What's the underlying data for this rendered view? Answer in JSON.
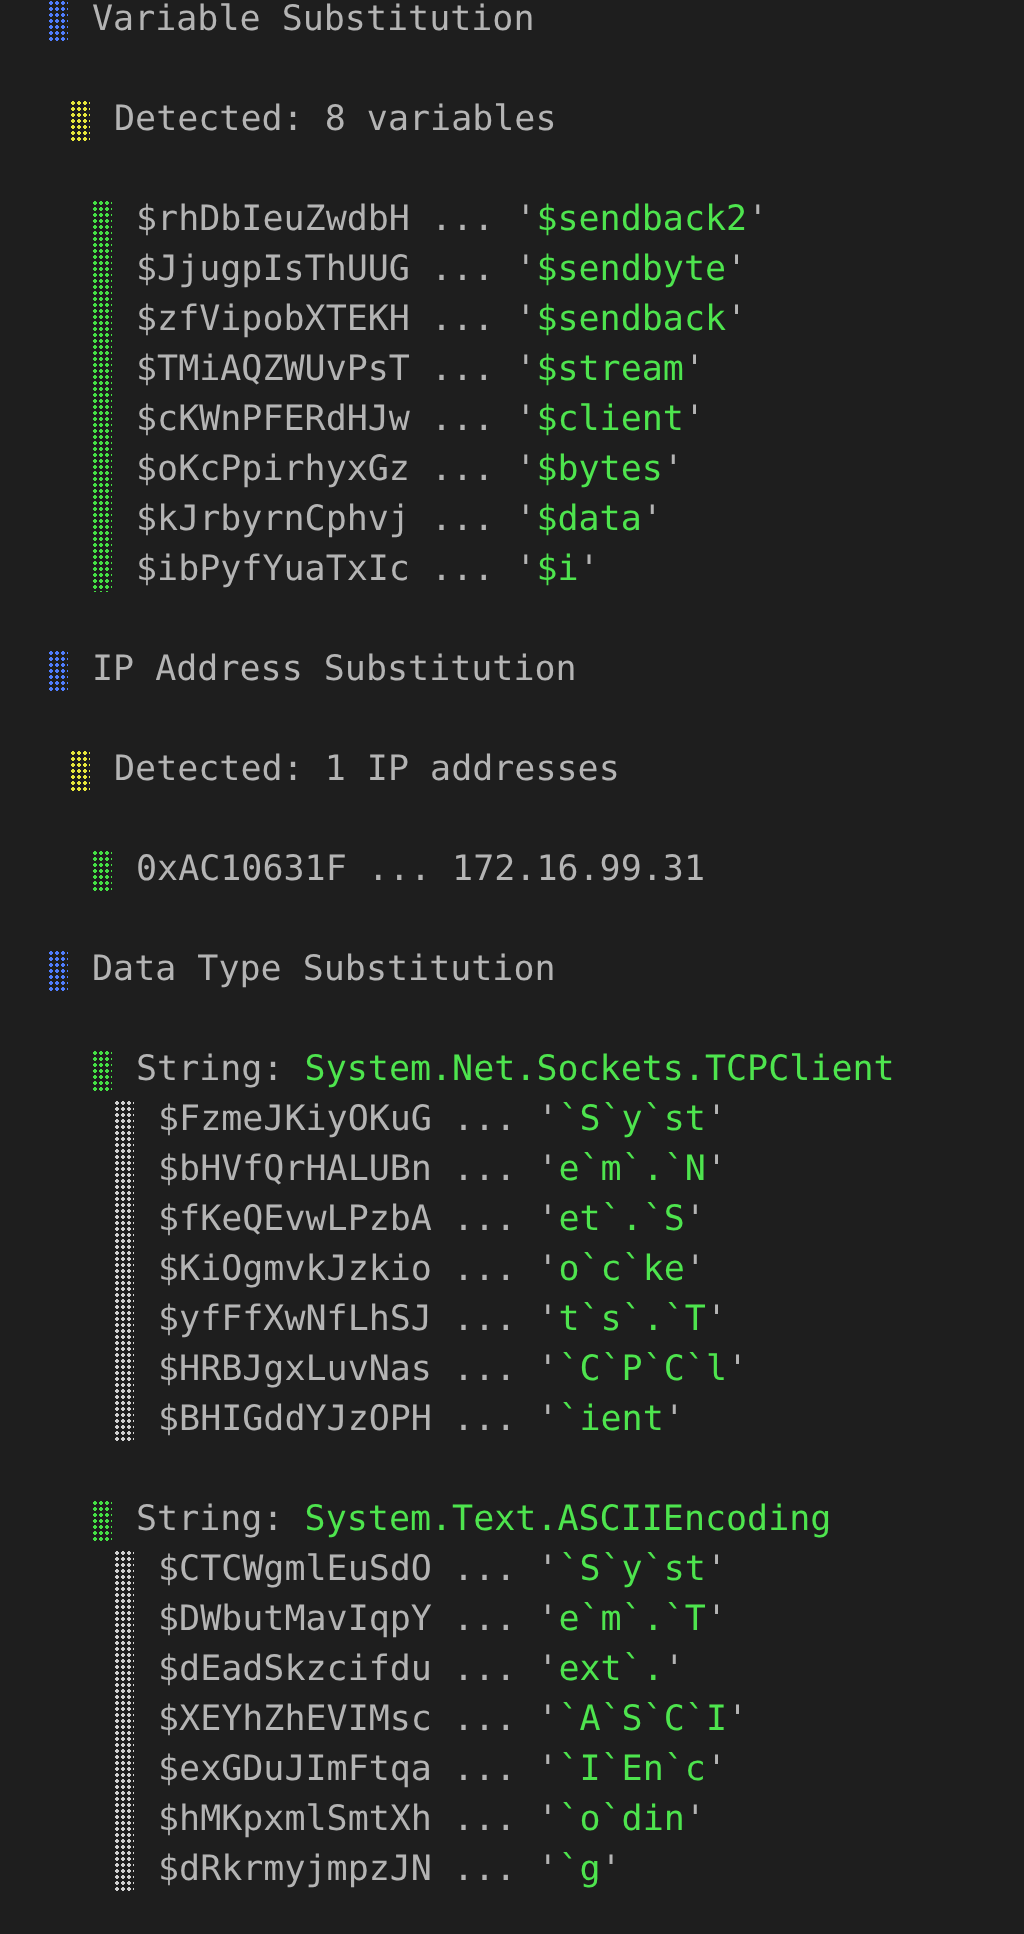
{
  "sections": [
    {
      "title": "Variable Substitution",
      "summary": "Detected: 8 variables",
      "groups": [
        {
          "kind": "mapping",
          "rows": [
            {
              "name": "$rhDbIeuZwdbH",
              "sep": "...",
              "value": "'$sendback2'"
            },
            {
              "name": "$JjugpIsThUUG",
              "sep": "...",
              "value": "'$sendbyte'"
            },
            {
              "name": "$zfVipobXTEKH",
              "sep": "...",
              "value": "'$sendback'"
            },
            {
              "name": "$TMiAQZWUvPsT",
              "sep": "...",
              "value": "'$stream'"
            },
            {
              "name": "$cKWnPFERdHJw",
              "sep": "...",
              "value": "'$client'"
            },
            {
              "name": "$oKcPpirhyxGz",
              "sep": "...",
              "value": "'$bytes'"
            },
            {
              "name": "$kJrbyrnCphvj",
              "sep": "...",
              "value": "'$data'"
            },
            {
              "name": "$ibPyfYuaTxIc",
              "sep": "...",
              "value": "'$i'"
            }
          ]
        }
      ]
    },
    {
      "title": "IP Address Substitution",
      "summary": "Detected: 1 IP addresses",
      "groups": [
        {
          "kind": "plain",
          "rows": [
            {
              "name": "0xAC10631F",
              "sep": "...",
              "value": "172.16.99.31"
            }
          ]
        }
      ]
    },
    {
      "title": "Data Type Substitution",
      "groups": [
        {
          "kind": "string",
          "label": "String:",
          "type_name": "System.Net.Sockets.TCPClient",
          "rows": [
            {
              "name": "$FzmeJKiyOKuG",
              "sep": "...",
              "value": "'`S`y`st'"
            },
            {
              "name": "$bHVfQrHALUBn",
              "sep": "...",
              "value": "'e`m`.`N'"
            },
            {
              "name": "$fKeQEvwLPzbA",
              "sep": "...",
              "value": "'et`.`S'"
            },
            {
              "name": "$KiOgmvkJzkio",
              "sep": "...",
              "value": "'o`c`ke'"
            },
            {
              "name": "$yfFfXwNfLhSJ",
              "sep": "...",
              "value": "'t`s`.`T'"
            },
            {
              "name": "$HRBJgxLuvNas",
              "sep": "...",
              "value": "'`C`P`C`l'"
            },
            {
              "name": "$BHIGddYJzOPH",
              "sep": "...",
              "value": "'`ient'"
            }
          ]
        },
        {
          "kind": "string",
          "label": "String:",
          "type_name": "System.Text.ASCIIEncoding",
          "rows": [
            {
              "name": "$CTCWgmlEuSdO",
              "sep": "...",
              "value": "'`S`y`st'"
            },
            {
              "name": "$DWbutMavIqpY",
              "sep": "...",
              "value": "'e`m`.`T'"
            },
            {
              "name": "$dEadSkzcifdu",
              "sep": "...",
              "value": "'ext`.'"
            },
            {
              "name": "$XEYhZhEVIMsc",
              "sep": "...",
              "value": "'`A`S`C`I'"
            },
            {
              "name": "$exGDuJImFtqa",
              "sep": "...",
              "value": "'`I`En`c'"
            },
            {
              "name": "$hMKpxmlSmtXh",
              "sep": "...",
              "value": "'`o`din'"
            },
            {
              "name": "$dRkrmyjmpzJN",
              "sep": "...",
              "value": "'`g'"
            }
          ]
        }
      ]
    }
  ]
}
